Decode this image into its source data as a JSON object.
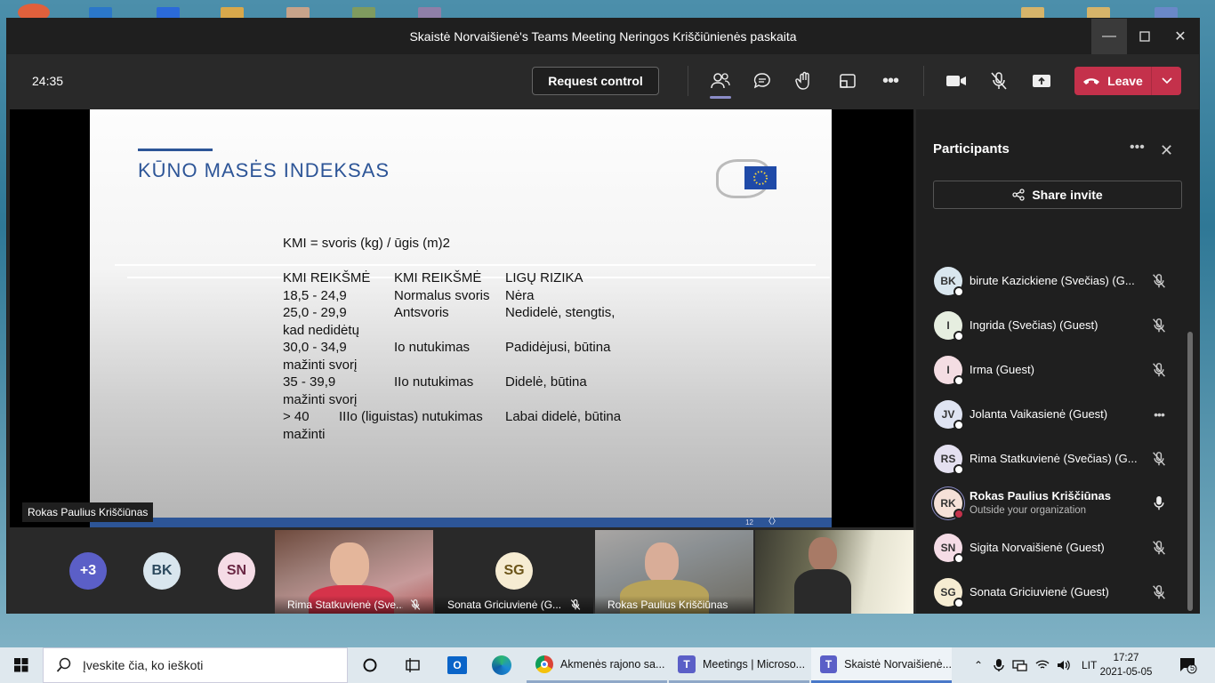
{
  "window": {
    "title": "Skaistė Norvaišienė's Teams Meeting Neringos Kriščiūnienės paskaita"
  },
  "toolbar": {
    "timer": "24:35",
    "request_control_label": "Request control",
    "leave_label": "Leave",
    "icons": [
      "participants-icon",
      "chat-icon",
      "raise-hand-icon",
      "room-icon",
      "more-actions-icon",
      "camera-icon",
      "mic-off-icon",
      "share-screen-icon"
    ]
  },
  "slide": {
    "title": "KŪNO MASĖS INDEKSAS",
    "formula": "KMI = svoris (kg) / ūgis (m)2",
    "page_number": "12",
    "rows": [
      {
        "c1": "KMI REIKŠMĖ",
        "c2": "KMI REIKŠMĖ",
        "c3": "LIGŲ RIZIKA"
      },
      {
        "c1": "18,5 - 24,9",
        "c2": "Normalus svoris",
        "c3": "Nėra"
      },
      {
        "c1": "25,0 - 29,9",
        "c2": "Antsvoris",
        "c3": "Nedidelė, stengtis,"
      },
      {
        "c1": "kad nedidėtų",
        "c2": "",
        "c3": ""
      },
      {
        "c1": "30,0 - 34,9",
        "c2": "Io nutukimas",
        "c3": "Padidėjusi, būtina"
      },
      {
        "c1": "mažinti svorį",
        "c2": "",
        "c3": ""
      },
      {
        "c1": "35 - 39,9",
        "c2": "IIo nutukimas",
        "c3": "Didelė, būtina"
      },
      {
        "c1": "mažinti svorį",
        "c2": "",
        "c3": ""
      },
      {
        "c1": "> 40",
        "c2": "IIIo (liguistas) nutukimas",
        "c3": "Labai didelė, būtina"
      },
      {
        "c1": "mažinti",
        "c2": "",
        "c3": ""
      }
    ]
  },
  "stage": {
    "presenter_label": "Rokas Paulius Kriščiūnas"
  },
  "strip": {
    "avatars": [
      {
        "initials": "+3",
        "bg": "#5b5fc7",
        "fg": "#ffffff"
      },
      {
        "initials": "BK",
        "bg": "#d9e6ee",
        "fg": "#2c4a5e"
      },
      {
        "initials": "SN",
        "bg": "#f5dce6",
        "fg": "#6b2844"
      }
    ],
    "tiles": [
      {
        "name": "Rima Statkuvienė (Sve...",
        "muted": true
      },
      {
        "name": "Sonata Griciuvienė (G...",
        "muted": true,
        "initials": "SG"
      },
      {
        "name": "Rokas Paulius Kriščiūnas",
        "muted": false
      },
      {
        "name": "",
        "muted": false
      }
    ]
  },
  "participants": {
    "title": "Participants",
    "share_invite_label": "Share invite",
    "list": [
      {
        "initials": "BK",
        "name": "birute Kazickiene (Svečias) (G...",
        "bg": "#d9e6ee",
        "action": "mic-off-icon"
      },
      {
        "initials": "I",
        "name": "Ingrida (Svečias) (Guest)",
        "bg": "#e6eee0",
        "action": "mic-off-icon"
      },
      {
        "initials": "I",
        "name": "Irma (Guest)",
        "bg": "#f4dde3",
        "action": "mic-off-icon"
      },
      {
        "initials": "JV",
        "name": "Jolanta Vaikasienė (Guest)",
        "bg": "#dfe4f2",
        "action": "more-icon"
      },
      {
        "initials": "RS",
        "name": "Rima Statkuvienė (Svečias) (G...",
        "bg": "#e4e0f0",
        "action": "mic-off-icon"
      },
      {
        "initials": "RK",
        "name": "Rokas Paulius Kriščiūnas",
        "sub": "Outside your organization",
        "bg": "#f6e1d8",
        "action": "mic-on-icon",
        "bold": true
      },
      {
        "initials": "SN",
        "name": "Sigita Norvaišienė (Guest)",
        "bg": "#f5dce6",
        "action": "mic-off-icon"
      },
      {
        "initials": "SG",
        "name": "Sonata Griciuvienė (Guest)",
        "bg": "#f6ecd2",
        "action": "mic-off-icon"
      }
    ]
  },
  "taskbar": {
    "search_placeholder": "Įveskite čia, ko ieškoti",
    "apps": [
      {
        "label": "Akmenės rajono sa...",
        "icon": "chrome-icon"
      },
      {
        "label": "Meetings | Microso...",
        "icon": "teams-icon"
      },
      {
        "label": "Skaistė Norvaišienė...",
        "icon": "teams-icon"
      }
    ],
    "language": "LIT",
    "time": "17:27",
    "date": "2021-05-05",
    "notification_count": "5"
  }
}
